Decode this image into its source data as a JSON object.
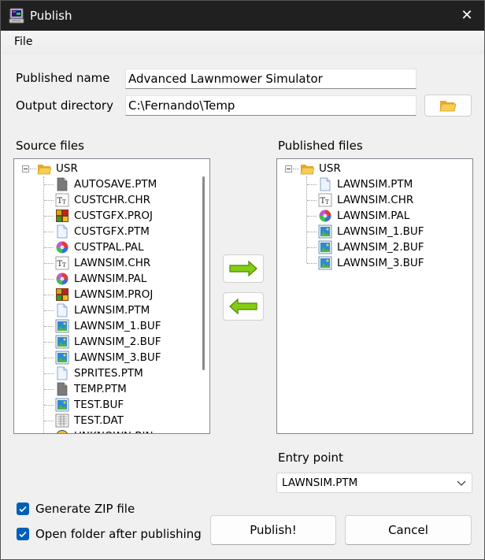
{
  "window": {
    "title": "Publish",
    "close_glyph": "✕"
  },
  "menu": {
    "file": "File"
  },
  "form": {
    "published_name_label": "Published name",
    "published_name_value": "Advanced Lawnmower Simulator",
    "output_dir_label": "Output directory",
    "output_dir_value": "C:\\Fernando\\Temp"
  },
  "source": {
    "label": "Source files",
    "root": "USR",
    "items": [
      {
        "name": "AUTOSAVE.PTM",
        "icon": "doc-gray-icon"
      },
      {
        "name": "CUSTCHR.CHR",
        "icon": "font-tt-icon"
      },
      {
        "name": "CUSTGFX.PROJ",
        "icon": "project-icon"
      },
      {
        "name": "CUSTGFX.PTM",
        "icon": "doc-blue-icon"
      },
      {
        "name": "CUSTPAL.PAL",
        "icon": "palette-icon"
      },
      {
        "name": "LAWNSIM.CHR",
        "icon": "font-tt-icon"
      },
      {
        "name": "LAWNSIM.PAL",
        "icon": "palette-icon"
      },
      {
        "name": "LAWNSIM.PROJ",
        "icon": "project-icon"
      },
      {
        "name": "LAWNSIM.PTM",
        "icon": "doc-blue-icon"
      },
      {
        "name": "LAWNSIM_1.BUF",
        "icon": "image-buffer-icon"
      },
      {
        "name": "LAWNSIM_2.BUF",
        "icon": "image-buffer-icon"
      },
      {
        "name": "LAWNSIM_3.BUF",
        "icon": "image-buffer-icon"
      },
      {
        "name": "SPRITES.PTM",
        "icon": "doc-blue-icon"
      },
      {
        "name": "TEMP.PTM",
        "icon": "doc-gray-icon"
      },
      {
        "name": "TEST.BUF",
        "icon": "image-buffer-icon"
      },
      {
        "name": "TEST.DAT",
        "icon": "data-icon"
      },
      {
        "name": "UNKNOWN.BIN",
        "icon": "unknown-icon"
      }
    ]
  },
  "published": {
    "label": "Published files",
    "root": "USR",
    "items": [
      {
        "name": "LAWNSIM.PTM",
        "icon": "doc-blue-icon"
      },
      {
        "name": "LAWNSIM.CHR",
        "icon": "font-tt-icon"
      },
      {
        "name": "LAWNSIM.PAL",
        "icon": "palette-icon"
      },
      {
        "name": "LAWNSIM_1.BUF",
        "icon": "image-buffer-icon"
      },
      {
        "name": "LAWNSIM_2.BUF",
        "icon": "image-buffer-icon"
      },
      {
        "name": "LAWNSIM_3.BUF",
        "icon": "image-buffer-icon"
      }
    ]
  },
  "entry": {
    "label": "Entry point",
    "value": "LAWNSIM.PTM"
  },
  "options": {
    "zip_label": "Generate ZIP file",
    "zip_checked": true,
    "open_label": "Open folder after publishing",
    "open_checked": true
  },
  "buttons": {
    "publish": "Publish!",
    "cancel": "Cancel"
  },
  "colors": {
    "accent": "#005fb8",
    "arrow_green": "#7cc400",
    "folder_yellow": "#f3c647"
  }
}
